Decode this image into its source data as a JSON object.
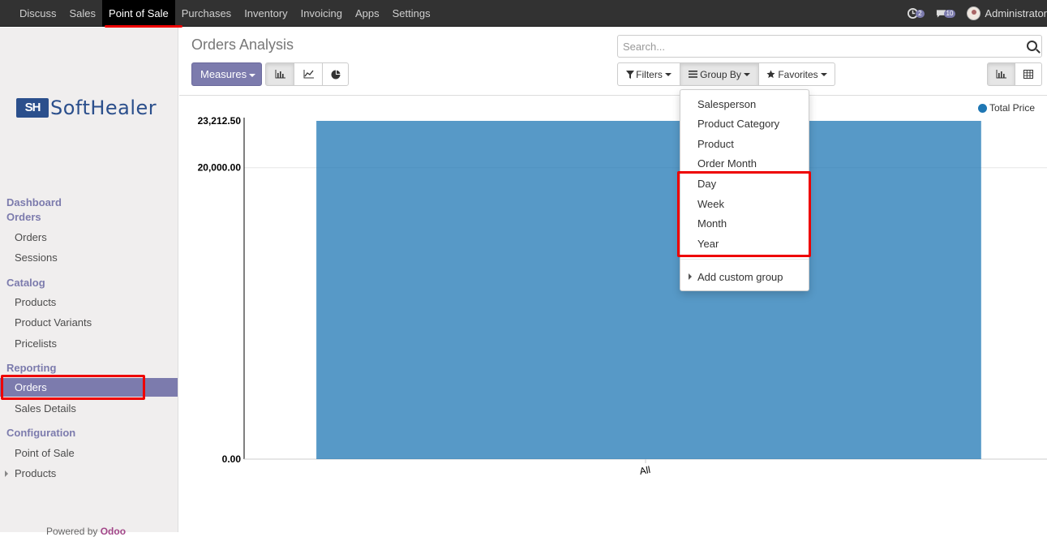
{
  "topbar": {
    "menu": [
      "Discuss",
      "Sales",
      "Point of Sale",
      "Purchases",
      "Inventory",
      "Invoicing",
      "Apps",
      "Settings"
    ],
    "active": "Point of Sale",
    "activity_count": "2",
    "message_count": "10",
    "user": "Administrator"
  },
  "sidebar": {
    "logo_mark": "SH",
    "logo_text": "SoftHealer",
    "sections": {
      "dashboard": "Dashboard",
      "orders": "Orders",
      "catalog": "Catalog",
      "reporting": "Reporting",
      "configuration": "Configuration"
    },
    "items": {
      "orders": "Orders",
      "sessions": "Sessions",
      "products": "Products",
      "product_variants": "Product Variants",
      "pricelists": "Pricelists",
      "reporting_orders": "Orders",
      "sales_details": "Sales Details",
      "point_of_sale": "Point of Sale",
      "config_products": "Products"
    },
    "powered_prefix": "Powered by",
    "powered_brand": "Odoo"
  },
  "control_panel": {
    "title": "Orders Analysis",
    "search_placeholder": "Search...",
    "measures_label": "Measures",
    "filters_label": "Filters",
    "group_by_label": "Group By",
    "favorites_label": "Favorites"
  },
  "group_by_menu": {
    "items": [
      "Salesperson",
      "Product Category",
      "Product",
      "Order Month",
      "Day",
      "Week",
      "Month",
      "Year"
    ],
    "add_custom": "Add custom group"
  },
  "chart_data": {
    "type": "bar",
    "categories": [
      "All"
    ],
    "series": [
      {
        "name": "Total Price",
        "values": [
          23212.5
        ]
      }
    ],
    "ylim": [
      0,
      23212.5
    ],
    "ytick_labels": [
      "0.00",
      "20,000.00",
      "23,212.50"
    ],
    "yticks": [
      0,
      20000,
      23212.5
    ],
    "color": "#1f77b4",
    "legend": "top-right"
  }
}
